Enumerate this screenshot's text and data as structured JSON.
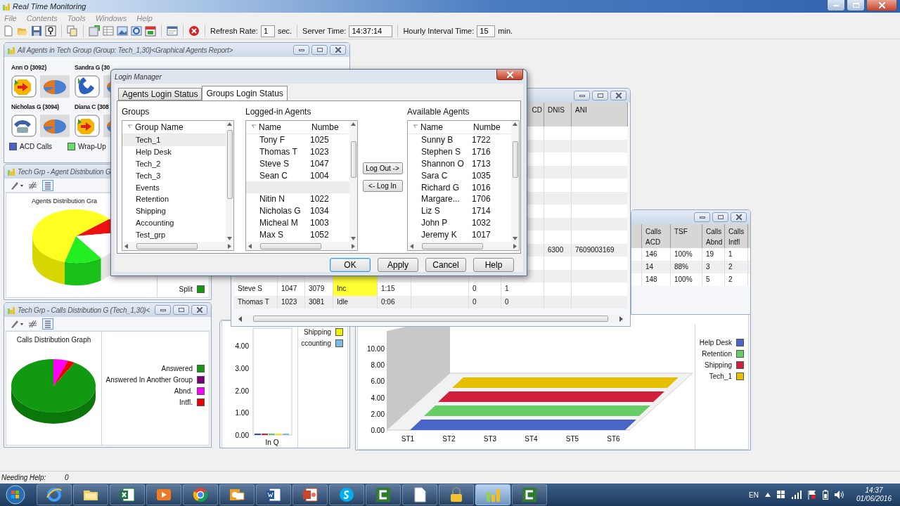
{
  "app": {
    "title": "Real Time Monitoring"
  },
  "menu": [
    "File",
    "Contents",
    "Tools",
    "Windows",
    "Help"
  ],
  "toolbar": {
    "refresh_label": "Refresh Rate:",
    "refresh_value": "1",
    "refresh_unit": "sec.",
    "server_label": "Server Time:",
    "server_value": "14:37:14",
    "interval_label": "Hourly Interval Time:",
    "interval_value": "15",
    "interval_unit": "min."
  },
  "agents_window": {
    "title": "All Agents in Tech Group  (Group: Tech_1,30)<Graphical Agents Report>",
    "agents": [
      {
        "name": "Ann O (3092)",
        "kind": "incoming"
      },
      {
        "name": "Sandra G (30",
        "kind": "phone"
      },
      {
        "name": "Nicholas G (3094)",
        "kind": "handset"
      },
      {
        "name": "Diana C (308",
        "kind": "incoming"
      }
    ],
    "legend": [
      {
        "label": "ACD Calls",
        "color": "#4a5fc8"
      },
      {
        "label": "Wrap-Up",
        "color": "#66dd66"
      }
    ]
  },
  "agent_distribution_window": {
    "title": "Tech Grp - Agent Distribution G",
    "chart_title": "Agents Distribution Gra",
    "legend": [
      {
        "label": "Split",
        "color": "#119911"
      }
    ]
  },
  "calls_distribution_window": {
    "title": "Tech Grp - Calls Distribution G  (Tech_1,30)<",
    "chart_title": "Calls Distribution Graph",
    "legend": [
      {
        "label": "Answered",
        "color": "#119911"
      },
      {
        "label": "Answered In Another Group",
        "color": "#770077"
      },
      {
        "label": "Abnd.",
        "color": "#ff00ff"
      },
      {
        "label": "Intfl.",
        "color": "#ee0000"
      }
    ]
  },
  "queue_chart": {
    "chart_data": {
      "type": "bar",
      "categories": [
        "In Q"
      ],
      "ylim": [
        0,
        4.8
      ],
      "yticks": [
        {
          "value": 0,
          "label": "0.00"
        },
        {
          "value": 1,
          "label": "1.00"
        },
        {
          "value": 2,
          "label": "2.00"
        },
        {
          "value": 3,
          "label": "3.00"
        },
        {
          "value": 4,
          "label": "4.00"
        }
      ],
      "series": [
        {
          "color": "#3344cc",
          "values": [
            0
          ]
        },
        {
          "color": "#dd2233",
          "values": [
            0
          ]
        },
        {
          "color": "#55cc55",
          "values": [
            0
          ]
        },
        {
          "name": "Shipping",
          "color": "#f2ee00",
          "values": [
            0
          ]
        },
        {
          "name": "ccounting",
          "color": "#77bde6",
          "values": [
            0
          ]
        }
      ]
    }
  },
  "group_chart": {
    "y_axis_labels": [
      "10.00",
      "8.00",
      "6.00",
      "4.00",
      "2.00",
      "0.00"
    ],
    "x_axis_labels": [
      "ST1",
      "ST2",
      "ST3",
      "ST4",
      "ST5",
      "ST6"
    ],
    "legend": [
      {
        "label": "Help Desk",
        "color": "#4a64c8"
      },
      {
        "label": "Retention",
        "color": "#66cc66"
      },
      {
        "label": "Shipping",
        "color": "#d0203c"
      },
      {
        "label": "Tech_1",
        "color": "#e6bf00"
      }
    ]
  },
  "group_table_window": {
    "columns": [
      "Calls ACD",
      "TSF",
      "Calls Abnd",
      "Calls Intfl"
    ],
    "rows": [
      [
        "146",
        "100%",
        "19",
        "1"
      ],
      [
        "14",
        "88%",
        "3",
        "2"
      ],
      [
        "148",
        "100%",
        "5",
        "2"
      ]
    ]
  },
  "agent_table_window": {
    "columns": [
      "CD",
      "DNIS",
      "ANI"
    ],
    "rows": [
      {},
      {},
      {},
      {},
      {},
      {},
      {},
      {},
      {},
      {
        "dnis": "6300",
        "ani": "7609003169"
      },
      {},
      {
        "highlighted": true
      },
      {
        "column_1": "Steve S",
        "column_2": "1047",
        "column_3": "3079",
        "column_4": "Inc",
        "column_5": "1:15",
        "column_7": "0",
        "cd": "1",
        "highlighted": true
      },
      {
        "column_1": "Thomas T",
        "column_2": "1023",
        "column_3": "3081",
        "column_4": "Idle",
        "column_5": "0:06",
        "column_7": "0",
        "cd": "0",
        "highlighted": false
      }
    ]
  },
  "login_dialog": {
    "title": "Login Manager",
    "tabs": [
      {
        "label": "Agents Login Status",
        "selected": false
      },
      {
        "label": "Groups Login Status",
        "selected": true
      }
    ],
    "groups": {
      "label": "Groups",
      "header": "Group Name",
      "rows": [
        {
          "name": "Tech_1",
          "selected": true
        },
        {
          "name": "Help Desk",
          "selected": false
        },
        {
          "name": "Tech_2",
          "selected": false
        },
        {
          "name": "Tech_3",
          "selected": false
        },
        {
          "name": "Events",
          "selected": false
        },
        {
          "name": "Retention",
          "selected": false
        },
        {
          "name": "Shipping",
          "selected": false
        },
        {
          "name": "Accounting",
          "selected": false
        },
        {
          "name": "Test_grp",
          "selected": false
        }
      ]
    },
    "logged_in": {
      "label": "Logged-in Agents",
      "headers": [
        "Name",
        "Numbe"
      ],
      "rows": [
        {
          "name": "Tony F",
          "number": "1025",
          "selected": false
        },
        {
          "name": "Thomas T",
          "number": "1023",
          "selected": false
        },
        {
          "name": "Steve S",
          "number": "1047",
          "selected": false
        },
        {
          "name": "Sean C",
          "number": "1004",
          "selected": false
        },
        {
          "selected": true
        },
        {
          "name": "Nitin N",
          "number": "1022",
          "selected": false
        },
        {
          "name": "Nicholas G",
          "number": "1034",
          "selected": false
        },
        {
          "name": "Micheal M",
          "number": "1003",
          "selected": false
        },
        {
          "name": "Max S",
          "number": "1052",
          "selected": false
        }
      ]
    },
    "available": {
      "label": "Available Agents",
      "headers": [
        "Name",
        "Numbe"
      ],
      "rows": [
        {
          "name": "Sunny B",
          "number": "1722",
          "selected": false
        },
        {
          "name": "Stephen S",
          "number": "1716",
          "selected": false
        },
        {
          "name": "Shannon O",
          "number": "1713",
          "selected": false
        },
        {
          "name": "Sara C",
          "number": "1035",
          "selected": false
        },
        {
          "name": "Richard G",
          "number": "1016",
          "selected": false
        },
        {
          "name": "Margare...",
          "number": "1706",
          "selected": false
        },
        {
          "name": "Liz S",
          "number": "1714",
          "selected": false
        },
        {
          "name": "John P",
          "number": "1032",
          "selected": false
        },
        {
          "name": "Jeremy K",
          "number": "1017",
          "selected": false
        }
      ]
    },
    "move_buttons": [
      "Log Out ->",
      "<- Log In"
    ],
    "buttons": [
      {
        "label": "OK",
        "default": true
      },
      {
        "label": "Apply",
        "default": false
      },
      {
        "label": "Cancel",
        "default": false
      },
      {
        "label": "Help",
        "default": false
      }
    ]
  },
  "status_bar": {
    "label": "Needing Help:",
    "value": "0"
  },
  "taskbar": {
    "apps": [
      {
        "kind": "browser",
        "selected": false
      },
      {
        "kind": "folder",
        "selected": false
      },
      {
        "kind": "spreadsheet",
        "selected": false
      },
      {
        "kind": "media",
        "selected": false
      },
      {
        "kind": "ring",
        "selected": false
      },
      {
        "kind": "mail",
        "selected": false
      },
      {
        "kind": "document",
        "selected": false
      },
      {
        "kind": "slides",
        "selected": false
      },
      {
        "kind": "chat",
        "selected": false
      },
      {
        "kind": "recorder",
        "selected": false
      },
      {
        "kind": "page",
        "selected": false
      },
      {
        "kind": "lock",
        "selected": false
      },
      {
        "kind": "chart",
        "selected": true
      },
      {
        "kind": "recorder",
        "selected": false
      }
    ],
    "language": "EN",
    "time": "14:37",
    "date": "01/06/2016"
  }
}
